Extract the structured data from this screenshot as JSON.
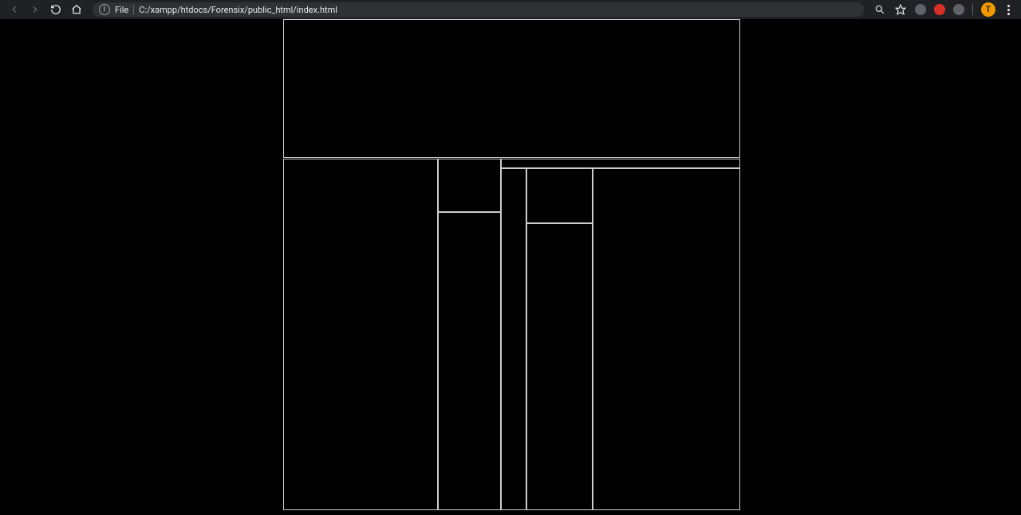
{
  "browser": {
    "url_scheme": "File",
    "url_path": "C:/xampp/htdocs/Forensix/public_html/index.html",
    "avatar_letter": "T"
  }
}
